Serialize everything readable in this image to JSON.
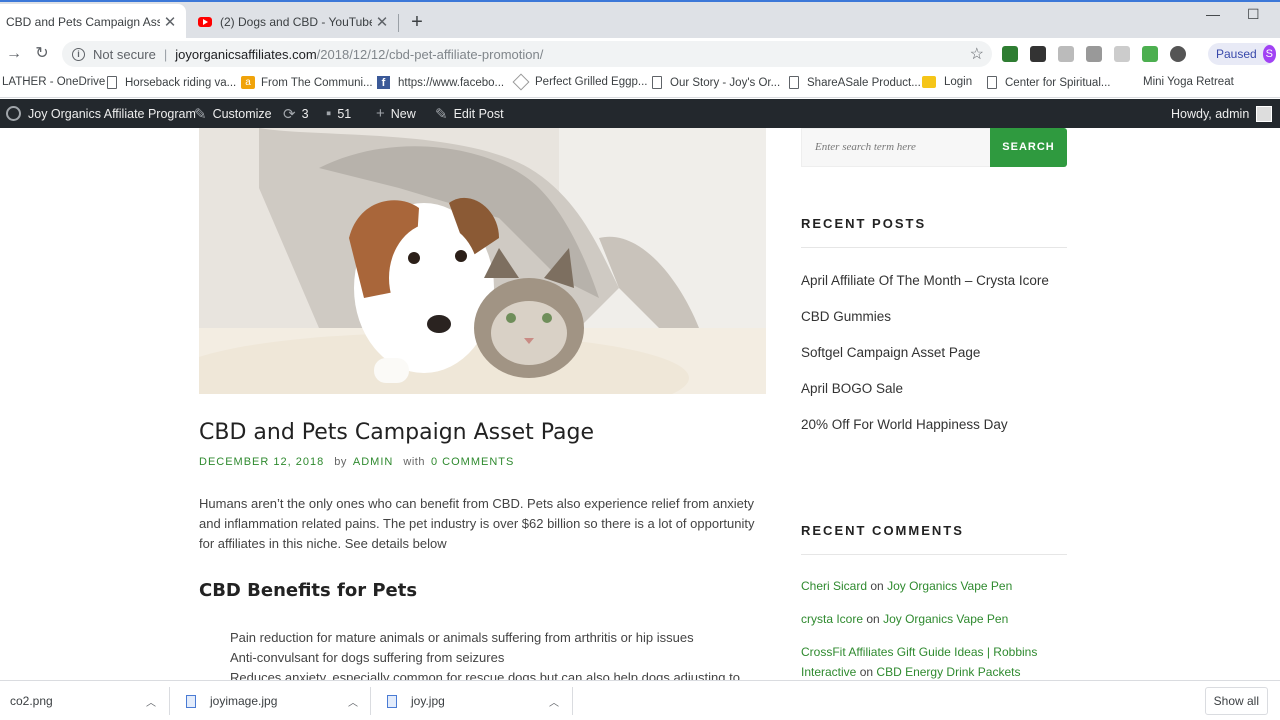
{
  "browser": {
    "tabs": [
      {
        "title": "CBD and Pets Campaign Asset Pa",
        "active": true
      },
      {
        "title": "(2) Dogs and CBD - YouTube",
        "active": false
      }
    ],
    "close_glyph": "✕",
    "new_tab_glyph": "+",
    "security_label": "Not secure",
    "url_host": "joyorganicsaffiliates.com",
    "url_path": "/2018/12/12/cbd-pet-affiliate-promotion/",
    "profile_status": "Paused",
    "profile_initial": "S"
  },
  "bookmarks": [
    {
      "label": "LATHER - OneDrive",
      "icon": "none"
    },
    {
      "label": "Horseback riding va...",
      "icon": "page-icon"
    },
    {
      "label": "From The Communi...",
      "icon": "rss-icon"
    },
    {
      "label": "https://www.facebo...",
      "icon": "facebook-icon"
    },
    {
      "label": "Perfect Grilled Eggp...",
      "icon": "generic-icon"
    },
    {
      "label": "Our Story - Joy's Or...",
      "icon": "page-icon"
    },
    {
      "label": "ShareASale Product...",
      "icon": "page-icon"
    },
    {
      "label": "Login",
      "icon": "lock-icon"
    },
    {
      "label": "Center for Spiritual...",
      "icon": "page-icon"
    },
    {
      "label": "Mini Yoga Retreat",
      "icon": "none"
    }
  ],
  "adminbar": {
    "site_name": "Joy Organics Affiliate Program",
    "customize": "Customize",
    "updates_count": "3",
    "comments_count": "51",
    "new_label": "New",
    "edit_label": "Edit Post",
    "howdy": "Howdy, admin"
  },
  "post": {
    "title": "CBD and Pets Campaign Asset Page",
    "date": "DECEMBER 12, 2018",
    "by": "by",
    "author": "ADMIN",
    "with": "with",
    "comments": "0 COMMENTS",
    "excerpt": "Humans aren’t the only ones who can benefit from CBD. Pets also experience relief from anxiety and inflammation related pains. The pet industry is over $62 billion so there is a lot of opportunity for affiliates in this niche. See details below",
    "subheading": "CBD Benefits for Pets",
    "bullets": [
      "Pain reduction for mature animals or animals suffering from arthritis or hip issues",
      "Anti-convulsant for dogs suffering from seizures",
      "Reduces anxiety, especially common for rescue dogs but can also help dogs adjusting to"
    ]
  },
  "sidebar": {
    "search_placeholder": "Enter search term here",
    "search_button": "SEARCH",
    "recent_posts_title": "RECENT POSTS",
    "recent_posts": [
      "April Affiliate Of The Month – Crysta Icore",
      "CBD Gummies",
      "Softgel Campaign Asset Page",
      "April BOGO Sale",
      "20% Off For World Happiness Day"
    ],
    "recent_comments_title": "RECENT COMMENTS",
    "recent_comments": [
      {
        "author": "Cheri Sicard",
        "on": "on",
        "post": "Joy Organics Vape Pen"
      },
      {
        "author": "crysta Icore",
        "on": "on",
        "post": "Joy Organics Vape Pen"
      },
      {
        "author": "CrossFit Affiliates Gift Guide Ideas | Robbins Interactive",
        "on": "on",
        "post": "CBD Energy Drink Packets"
      }
    ]
  },
  "downloads": {
    "files": [
      "co2.png",
      "joyimage.jpg",
      "joy.jpg"
    ],
    "show_all": "Show all"
  },
  "colors": {
    "accent_green": "#2f9a3f",
    "admin_bar": "#23282d",
    "link_green": "#2f8a2f"
  }
}
